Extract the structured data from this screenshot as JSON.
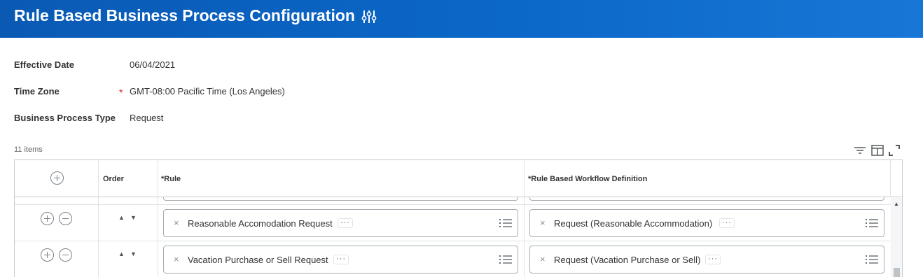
{
  "header": {
    "title": "Rule Based Business Process Configuration",
    "icon": "related-actions-sliders-icon",
    "background": "#0b62c4"
  },
  "fields": [
    {
      "label": "Effective Date",
      "value": "06/04/2021",
      "required": false
    },
    {
      "label": "Time Zone",
      "value": "GMT-08:00 Pacific Time (Los Angeles)",
      "required": true
    },
    {
      "label": "Business Process Type",
      "value": "Request",
      "required": false
    }
  ],
  "required_marker": "*",
  "grid": {
    "items_count": "11 items",
    "tools": [
      "filter-icon",
      "columns-icon",
      "fullscreen-icon"
    ],
    "columns": {
      "order": "Order",
      "rule": "*Rule",
      "definition": "*Rule Based Workflow Definition"
    },
    "rows": [
      {
        "rule": "Reasonable Accomodation Request",
        "definition": "Request (Reasonable Accommodation)"
      },
      {
        "rule": "Vacation Purchase or Sell Request",
        "definition": "Request (Vacation Purchase or Sell)"
      }
    ],
    "remove_glyph": "×",
    "more_glyph": "···",
    "up_arrow": "▲",
    "down_arrow": "▼"
  },
  "colors": {
    "required": "#de1f1f",
    "border": "#c7cbd0",
    "text": "#333333"
  }
}
